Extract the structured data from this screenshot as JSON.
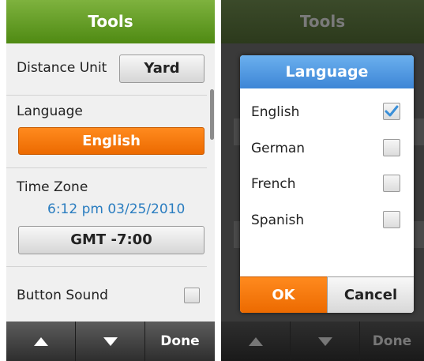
{
  "header": {
    "title": "Tools"
  },
  "settings": {
    "distance_unit": {
      "label": "Distance Unit",
      "value": "Yard"
    },
    "language": {
      "label": "Language",
      "value": "English"
    },
    "time_zone": {
      "label": "Time Zone",
      "timestamp": "6:12 pm 03/25/2010",
      "value": "GMT -7:00"
    },
    "button_sound": {
      "label": "Button Sound",
      "checked": false
    }
  },
  "bottom_bar": {
    "up_icon": "up-arrow-icon",
    "down_icon": "down-arrow-icon",
    "done_label": "Done"
  },
  "language_dialog": {
    "title": "Language",
    "options": [
      {
        "label": "English",
        "checked": true
      },
      {
        "label": "German",
        "checked": false
      },
      {
        "label": "French",
        "checked": false
      },
      {
        "label": "Spanish",
        "checked": false
      }
    ],
    "ok_label": "OK",
    "cancel_label": "Cancel"
  },
  "colors": {
    "header_green": "#5e9a1f",
    "accent_orange": "#f07300",
    "dialog_blue": "#4a92df",
    "timestamp_blue": "#2a7dc0",
    "check_blue": "#3a8fd8"
  }
}
